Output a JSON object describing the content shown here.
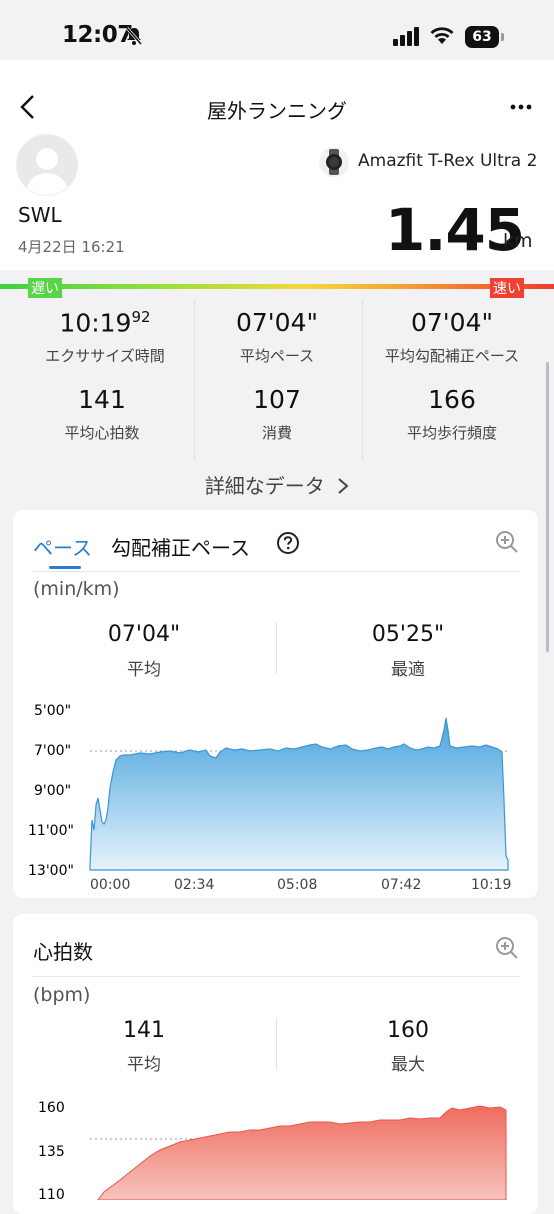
{
  "status_bar": {
    "time": "12:07",
    "battery": "63"
  },
  "header": {
    "title": "屋外ランニング"
  },
  "summary": {
    "username": "SWL",
    "datetime": "4月22日 16:21",
    "device": "Amazfit T-Rex Ultra 2",
    "distance": "1.45",
    "distance_unit": "km",
    "slow_label": "遅い",
    "fast_label": "速い"
  },
  "stats": [
    {
      "value": "10:19",
      "sup": "92",
      "label": "エクササイズ時間"
    },
    {
      "value": "07'04\"",
      "label": "平均ペース"
    },
    {
      "value": "07'04\"",
      "label": "平均勾配補正ペース"
    },
    {
      "value": "141",
      "label": "平均心拍数"
    },
    {
      "value": "107",
      "label": "消費"
    },
    {
      "value": "166",
      "label": "平均歩行頻度"
    }
  ],
  "details_link": "詳細なデータ",
  "pace_card": {
    "tabs": [
      "ペース",
      "勾配補正ペース"
    ],
    "unit": "(min/km)",
    "avg_value": "07'04\"",
    "avg_label": "平均",
    "best_value": "05'25\"",
    "best_label": "最適",
    "y_ticks": [
      "5'00\"",
      "7'00\"",
      "9'00\"",
      "11'00\"",
      "13'00\""
    ],
    "x_ticks": [
      "00:00",
      "02:34",
      "05:08",
      "07:42",
      "10:19"
    ],
    "color": "#4aa3dd"
  },
  "hr_card": {
    "title": "心拍数",
    "unit": "(bpm)",
    "avg_value": "141",
    "avg_label": "平均",
    "max_value": "160",
    "max_label": "最大",
    "y_ticks": [
      "160",
      "135",
      "110"
    ],
    "color": "#ef6d5f"
  },
  "chart_data": [
    {
      "type": "area",
      "ylabel": "(min/km)",
      "x": [
        "00:00",
        "02:34",
        "05:08",
        "07:42",
        "10:19"
      ],
      "ylim": [
        "5'00\"",
        "13'00\""
      ],
      "y_reversed": true,
      "reference_line": "7'04\"",
      "series": [
        {
          "values_min_per_km": [
            12.5,
            10.6,
            7.4,
            7.1,
            7.2,
            7.0,
            7.3,
            7.0,
            6.9,
            7.0,
            6.8,
            6.9,
            6.8,
            7.0,
            6.7,
            6.0,
            6.8,
            6.9,
            12.8
          ]
        }
      ]
    },
    {
      "type": "area",
      "ylabel": "(bpm)",
      "y_ticks": [
        160,
        135,
        110
      ],
      "reference_line": 141,
      "series": [
        {
          "values_bpm": [
            105,
            112,
            122,
            130,
            138,
            143,
            146,
            148,
            150,
            151,
            152,
            153,
            154,
            155,
            157,
            158,
            159,
            158
          ]
        }
      ]
    }
  ]
}
